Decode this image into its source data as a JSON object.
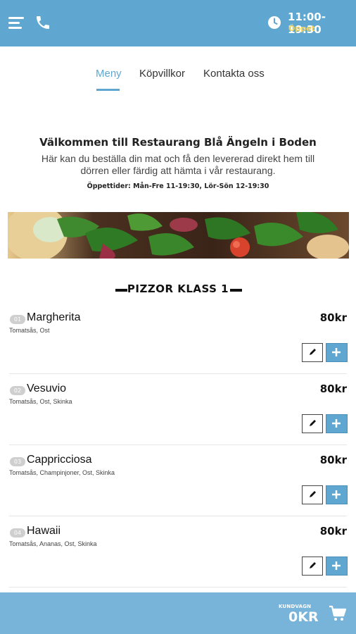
{
  "header": {
    "hours": "11:00-19:30",
    "status": "Öppet",
    "icons": {
      "menu": "hamburger-menu-icon",
      "phone": "phone-icon",
      "clock": "clock-icon"
    }
  },
  "tabs": [
    {
      "label": "Meny",
      "active": true
    },
    {
      "label": "Köpvillkor",
      "active": false
    },
    {
      "label": "Kontakta oss",
      "active": false
    }
  ],
  "intro": {
    "title": "Välkommen till Restaurang Blå Ängeln i Boden",
    "description": "Här kan du beställa din mat och få den levererad direkt hem till dörren eller färdig att hämta i vår restaurang.",
    "opening_hours": "Öppettider: Mån-Fre 11-19:30, Lör-Sön 12-19:30"
  },
  "section": {
    "title": "PIZZOR KLASS 1"
  },
  "items": [
    {
      "num": "01",
      "name": "Margherita",
      "ingredients": "Tomatsås, Ost",
      "price": "80kr"
    },
    {
      "num": "02",
      "name": "Vesuvio",
      "ingredients": "Tomatsås, Ost, Skinka",
      "price": "80kr"
    },
    {
      "num": "03",
      "name": "Cappricciosa",
      "ingredients": "Tomatsås, Champinjoner, Ost, Skinka",
      "price": "80kr"
    },
    {
      "num": "04",
      "name": "Hawaii",
      "ingredients": "Tomatsås, Ananas, Ost, Skinka",
      "price": "80kr"
    }
  ],
  "cart": {
    "label": "KUNDVAGN",
    "total": "0KR",
    "icon": "shopping-cart-icon"
  },
  "colors": {
    "primary": "#5fa7d0",
    "cart_bar": "#78b4da",
    "status_open": "#f7d55c"
  }
}
